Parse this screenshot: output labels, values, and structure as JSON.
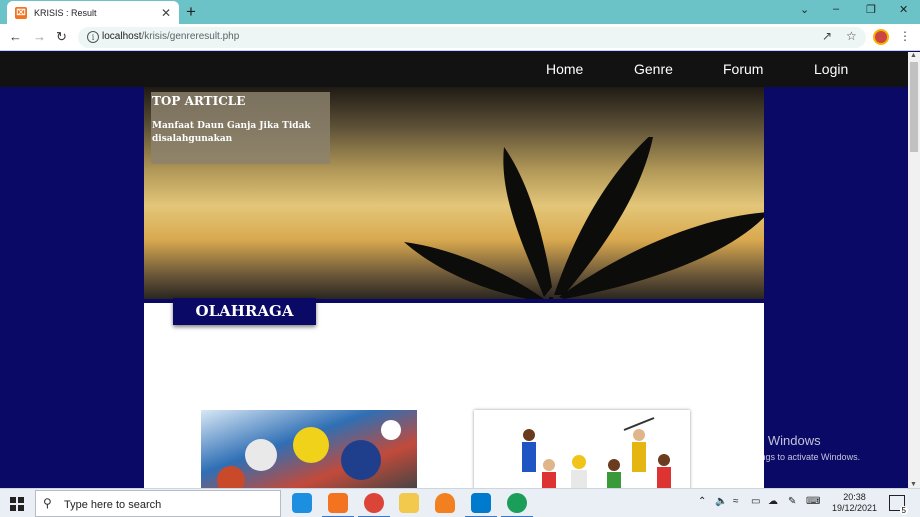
{
  "browser": {
    "tab_title": "KRISIS : Result",
    "url_host": "localhost",
    "url_path": "/krisis/genreresult.php"
  },
  "nav": {
    "links": [
      "Home",
      "Genre",
      "Forum",
      "Login"
    ]
  },
  "hero": {
    "section_title": "TOP ARTICLE",
    "article_title": "Manfaat Daun Ganja Jika Tidak disalahgunakan"
  },
  "genre": {
    "label": "OLAHRAGA"
  },
  "watermark": {
    "title": "Activate Windows",
    "subtitle": "Go to Settings to activate Windows."
  },
  "taskbar": {
    "search_placeholder": "Type here to search",
    "time": "20:38",
    "date": "19/12/2021",
    "notification_count": "5"
  },
  "colors": {
    "page_background": "#0a0a66",
    "nav_background": "#121212",
    "tab_strip": "#6cc3c7"
  }
}
